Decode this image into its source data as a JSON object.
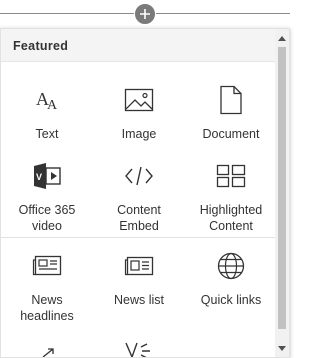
{
  "panel": {
    "title": "Featured"
  },
  "tiles": [
    {
      "label": "Text",
      "icon": "text-icon"
    },
    {
      "label": "Image",
      "icon": "image-icon"
    },
    {
      "label": "Document",
      "icon": "document-icon"
    },
    {
      "label": "Office 365\nvideo",
      "icon": "office-365-video-icon"
    },
    {
      "label": "Content\nEmbed",
      "icon": "code-embed-icon"
    },
    {
      "label": "Highlighted\nContent",
      "icon": "highlighted-content-icon"
    },
    {
      "label": "News\nheadlines",
      "icon": "news-headlines-icon"
    },
    {
      "label": "News list",
      "icon": "news-list-icon"
    },
    {
      "label": "Quick links",
      "icon": "globe-icon"
    }
  ],
  "colors": {
    "icon": "#333333",
    "add_button": "#7a7a7a",
    "header_bg": "#f4f4f4"
  }
}
